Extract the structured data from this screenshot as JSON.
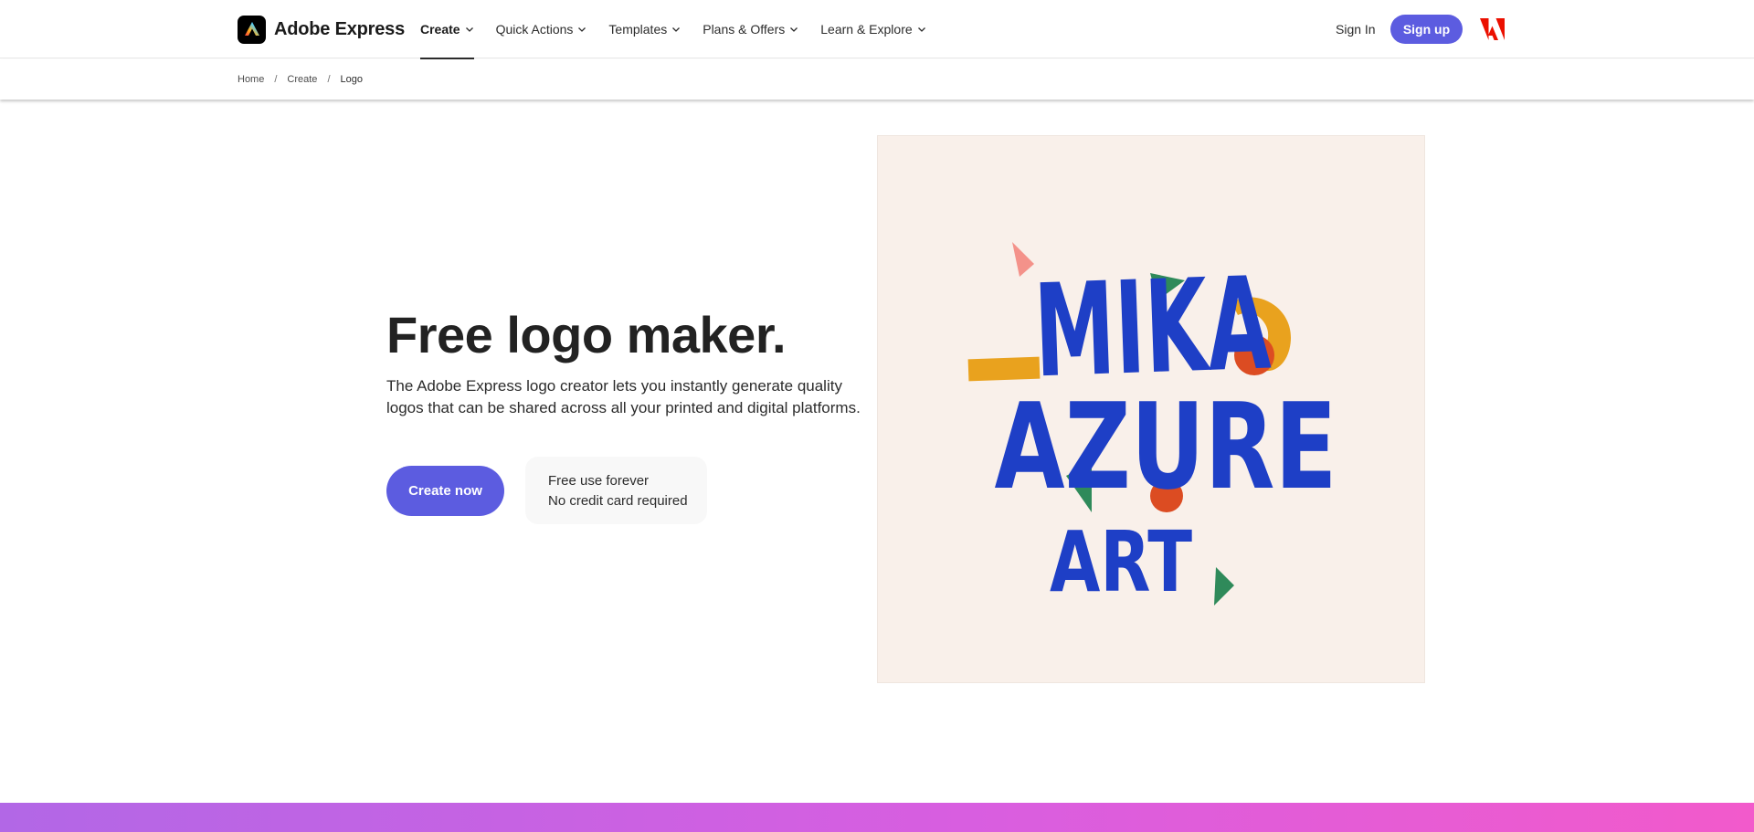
{
  "header": {
    "brand": "Adobe Express",
    "nav": [
      {
        "label": "Create",
        "active": true
      },
      {
        "label": "Quick Actions",
        "active": false
      },
      {
        "label": "Templates",
        "active": false
      },
      {
        "label": "Plans & Offers",
        "active": false
      },
      {
        "label": "Learn & Explore",
        "active": false
      }
    ],
    "sign_in": "Sign In",
    "sign_up": "Sign up"
  },
  "breadcrumb": {
    "items": [
      "Home",
      "Create",
      "Logo"
    ],
    "separator": "/"
  },
  "hero": {
    "title": "Free logo maker.",
    "description": "The Adobe Express logo creator lets you instantly generate quality logos that can be shared across all your printed and digital platforms.",
    "cta": "Create now",
    "badges": [
      "Free use forever",
      "No credit card required"
    ]
  },
  "artwork": {
    "lines": [
      "MIKA",
      "AZURE",
      "ART"
    ],
    "background": "#f9f0ea",
    "text_color": "#1e3fc6",
    "accents": [
      "#e9a21e",
      "#dc4c22",
      "#2f8a5a",
      "#f4928a"
    ]
  },
  "colors": {
    "accent": "#5c5ce0",
    "adobe_red": "#eb1000"
  },
  "icons": [
    "adobe-express-logo-icon",
    "chevron-down-icon",
    "adobe-logo-icon"
  ]
}
